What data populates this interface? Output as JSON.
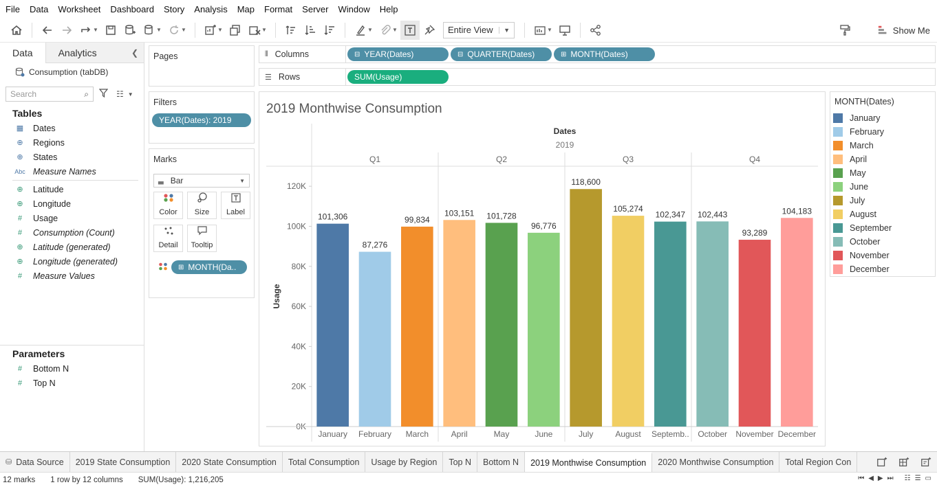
{
  "menu": [
    "File",
    "Data",
    "Worksheet",
    "Dashboard",
    "Story",
    "Analysis",
    "Map",
    "Format",
    "Server",
    "Window",
    "Help"
  ],
  "toolbar": {
    "view_mode": "Entire View",
    "show_me": "Show Me"
  },
  "data_pane": {
    "tabs": [
      "Data",
      "Analytics"
    ],
    "datasource": "Consumption (tabDB)",
    "search_placeholder": "Search",
    "tables_title": "Tables",
    "dimensions": [
      {
        "label": "Dates",
        "icon": "calendar-icon"
      },
      {
        "label": "Regions",
        "icon": "globe-icon"
      },
      {
        "label": "States",
        "icon": "globe-icon"
      },
      {
        "label": "Measure Names",
        "icon": "abc-icon"
      }
    ],
    "measures": [
      {
        "label": "Latitude",
        "icon": "globe-icon"
      },
      {
        "label": "Longitude",
        "icon": "globe-icon"
      },
      {
        "label": "Usage",
        "icon": "hash-icon"
      },
      {
        "label": "Consumption (Count)",
        "icon": "hash-icon"
      },
      {
        "label": "Latitude (generated)",
        "icon": "globe-icon"
      },
      {
        "label": "Longitude (generated)",
        "icon": "globe-icon"
      },
      {
        "label": "Measure Values",
        "icon": "hash-icon"
      }
    ],
    "parameters_title": "Parameters",
    "parameters": [
      "Bottom N",
      "Top N"
    ]
  },
  "pages": {
    "title": "Pages"
  },
  "filters": {
    "title": "Filters",
    "pill": "YEAR(Dates): 2019"
  },
  "marks": {
    "title": "Marks",
    "type": "Bar",
    "buttons": [
      "Color",
      "Size",
      "Label",
      "Detail",
      "Tooltip"
    ],
    "color_pill": "MONTH(Da.."
  },
  "columns": {
    "label": "Columns",
    "pills": [
      "YEAR(Dates)",
      "QUARTER(Dates)",
      "MONTH(Dates)"
    ]
  },
  "rows": {
    "label": "Rows",
    "pills": [
      "SUM(Usage)"
    ]
  },
  "chart_data": {
    "type": "bar",
    "title": "2019 Monthwise Consumption",
    "header_title": "Dates",
    "year": "2019",
    "quarters": [
      "Q1",
      "Q2",
      "Q3",
      "Q4"
    ],
    "categories": [
      "January",
      "February",
      "March",
      "April",
      "May",
      "June",
      "July",
      "August",
      "September",
      "October",
      "November",
      "December"
    ],
    "tick_labels": [
      "January",
      "February",
      "March",
      "April",
      "May",
      "June",
      "July",
      "August",
      "Septemb..",
      "October",
      "November",
      "December"
    ],
    "values": [
      101306,
      87276,
      99834,
      103151,
      101728,
      96776,
      118600,
      105274,
      102347,
      102443,
      93289,
      104183
    ],
    "value_labels": [
      "101,306",
      "87,276",
      "99,834",
      "103,151",
      "101,728",
      "96,776",
      "118,600",
      "105,274",
      "102,347",
      "102,443",
      "93,289",
      "104,183"
    ],
    "colors": [
      "#4e79a7",
      "#a0cbe8",
      "#f28e2b",
      "#ffbe7d",
      "#59a14f",
      "#8cd17d",
      "#b6992d",
      "#f1ce63",
      "#499894",
      "#86bcb6",
      "#e15759",
      "#ff9d9a"
    ],
    "ylabel": "Usage",
    "ylim": [
      0,
      130000
    ],
    "yticks": [
      0,
      20000,
      40000,
      60000,
      80000,
      100000,
      120000
    ],
    "ytick_labels": [
      "0K",
      "20K",
      "40K",
      "60K",
      "80K",
      "100K",
      "120K"
    ]
  },
  "legend": {
    "title": "MONTH(Dates)"
  },
  "sheet_tabs": {
    "datasource": "Data Source",
    "sheets": [
      "2019 State Consumption",
      "2020 State Consumption",
      "Total Consumption",
      "Usage by Region",
      "Top N",
      "Bottom N",
      "2019 Monthwise Consumption",
      "2020 Monthwise Consumption",
      "Total Region Con"
    ],
    "active": "2019 Monthwise Consumption"
  },
  "status": {
    "marks": "12 marks",
    "layout": "1 row by 12 columns",
    "sum": "SUM(Usage): 1,216,205"
  }
}
